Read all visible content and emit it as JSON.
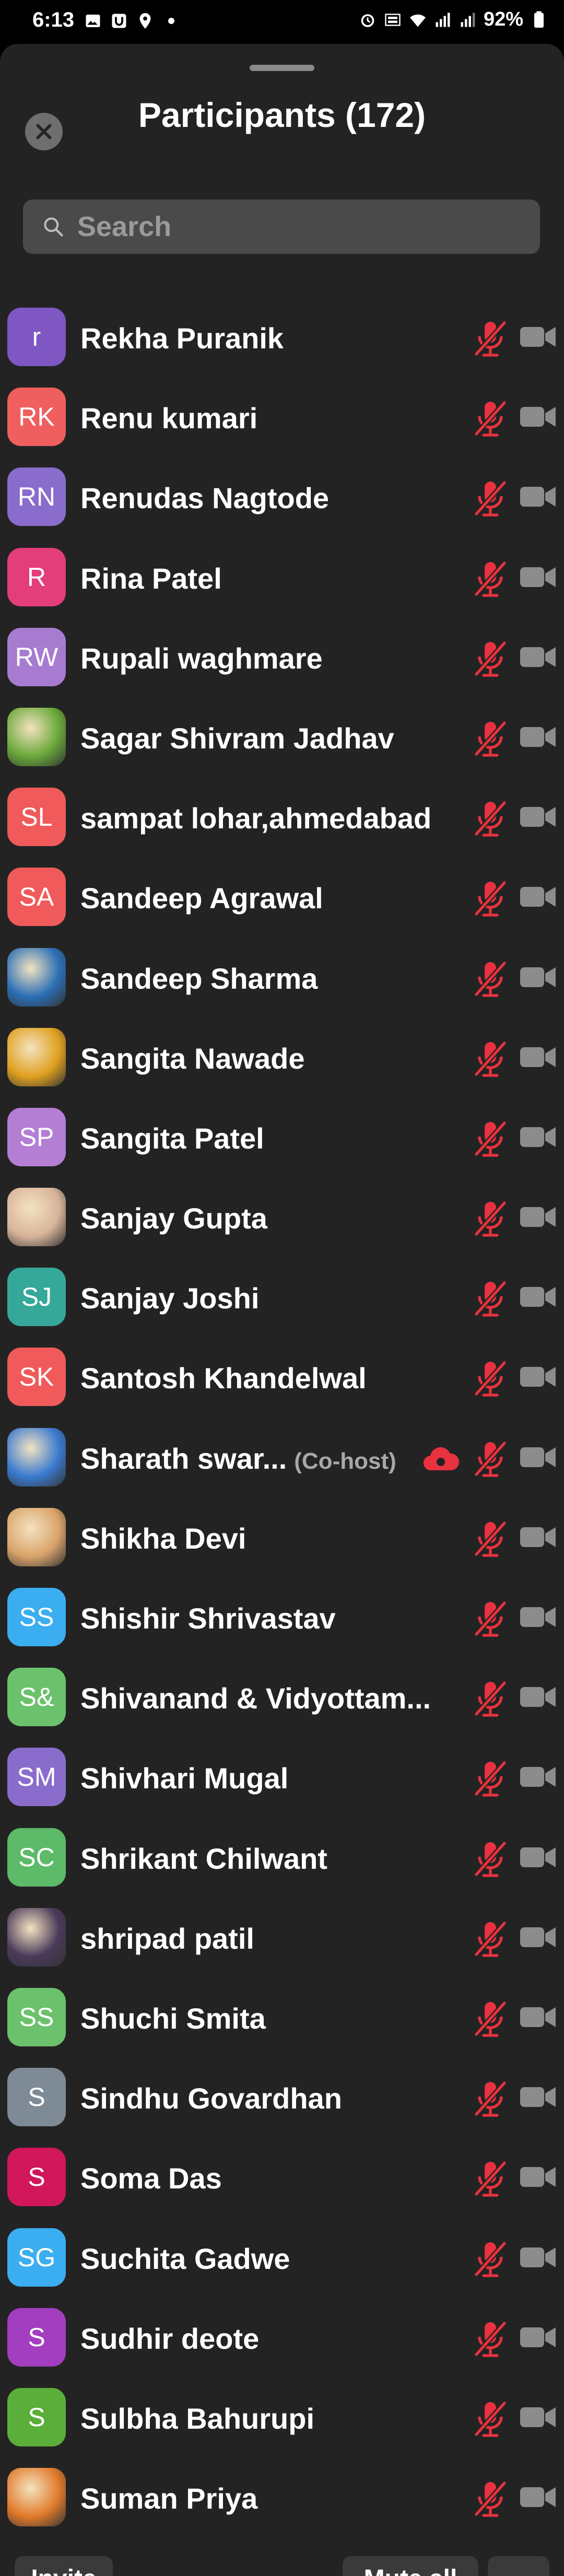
{
  "status_bar": {
    "time": "6:13",
    "battery": "92%"
  },
  "header": {
    "title": "Participants (172)",
    "close_icon": "close-icon"
  },
  "search": {
    "placeholder": "Search"
  },
  "participants": [
    {
      "name": "Rekha Puranik",
      "initials": "r",
      "avatar_color": "#7e57c2",
      "avatar_type": "initials"
    },
    {
      "name": "Renu kumari",
      "initials": "RK",
      "avatar_color": "#ef5f5f",
      "avatar_type": "initials"
    },
    {
      "name": "Renudas Nagtode",
      "initials": "RN",
      "avatar_color": "#8a6ccc",
      "avatar_type": "initials"
    },
    {
      "name": "Rina Patel",
      "initials": "R",
      "avatar_color": "#e33d7a",
      "avatar_type": "initials"
    },
    {
      "name": "Rupali waghmare",
      "initials": "RW",
      "avatar_color": "#a77bd0",
      "avatar_type": "initials"
    },
    {
      "name": "Sagar Shivram Jadhav",
      "initials": "",
      "avatar_color": "#6aa83a",
      "avatar_type": "photo"
    },
    {
      "name": "sampat lohar,ahmedabad",
      "initials": "SL",
      "avatar_color": "#f05a5a",
      "avatar_type": "initials"
    },
    {
      "name": "Sandeep Agrawal",
      "initials": "SA",
      "avatar_color": "#f05a5a",
      "avatar_type": "initials"
    },
    {
      "name": "Sandeep Sharma",
      "initials": "",
      "avatar_color": "#2b6fb5",
      "avatar_type": "photo"
    },
    {
      "name": "Sangita Nawade",
      "initials": "",
      "avatar_color": "#e0a020",
      "avatar_type": "photo"
    },
    {
      "name": "Sangita Patel",
      "initials": "SP",
      "avatar_color": "#b47ed4",
      "avatar_type": "initials"
    },
    {
      "name": "Sanjay Gupta",
      "initials": "",
      "avatar_color": "#d8b39a",
      "avatar_type": "photo"
    },
    {
      "name": "Sanjay Joshi",
      "initials": "SJ",
      "avatar_color": "#35a89a",
      "avatar_type": "initials"
    },
    {
      "name": "Santosh Khandelwal",
      "initials": "SK",
      "avatar_color": "#f05a5a",
      "avatar_type": "initials"
    },
    {
      "name": "Sharath swar...",
      "initials": "",
      "avatar_color": "#3a7ad0",
      "avatar_type": "photo",
      "badge": "(Co-host)",
      "cloud_recording": true
    },
    {
      "name": "Shikha Devi",
      "initials": "",
      "avatar_color": "#d9a36a",
      "avatar_type": "photo"
    },
    {
      "name": "Shishir Shrivastav",
      "initials": "SS",
      "avatar_color": "#3aaef0",
      "avatar_type": "initials"
    },
    {
      "name": "Shivanand & Vidyottam...",
      "initials": "S&",
      "avatar_color": "#6cc16c",
      "avatar_type": "initials"
    },
    {
      "name": "Shivhari Mugal",
      "initials": "SM",
      "avatar_color": "#8a6ccc",
      "avatar_type": "initials"
    },
    {
      "name": "Shrikant Chilwant",
      "initials": "SC",
      "avatar_color": "#5cba68",
      "avatar_type": "initials"
    },
    {
      "name": "shripad patil",
      "initials": "",
      "avatar_color": "#4a3a5a",
      "avatar_type": "photo"
    },
    {
      "name": "Shuchi Smita",
      "initials": "SS",
      "avatar_color": "#6cc16c",
      "avatar_type": "initials"
    },
    {
      "name": "Sindhu Govardhan",
      "initials": "S",
      "avatar_color": "#7e8a96",
      "avatar_type": "initials"
    },
    {
      "name": "Soma Das",
      "initials": "S",
      "avatar_color": "#d1165a",
      "avatar_type": "initials"
    },
    {
      "name": "Suchita Gadwe",
      "initials": "SG",
      "avatar_color": "#3aaef0",
      "avatar_type": "initials"
    },
    {
      "name": "Sudhir deote",
      "initials": "S",
      "avatar_color": "#a33ec0",
      "avatar_type": "initials"
    },
    {
      "name": "Sulbha Bahurupi",
      "initials": "S",
      "avatar_color": "#5cae3a",
      "avatar_type": "initials"
    },
    {
      "name": "Suman Priya",
      "initials": "",
      "avatar_color": "#e07a2a",
      "avatar_type": "photo"
    }
  ],
  "icons": {
    "mic": "mic-muted-icon",
    "video": "video-off-icon",
    "cloud": "cloud-recording-icon"
  },
  "colors": {
    "muted_red": "#e8323f",
    "video_gray": "#8c8c8c",
    "sheet_bg": "#232323"
  },
  "footer": {
    "invite": "Invite",
    "mute_all": "Mute all",
    "more": "···"
  }
}
